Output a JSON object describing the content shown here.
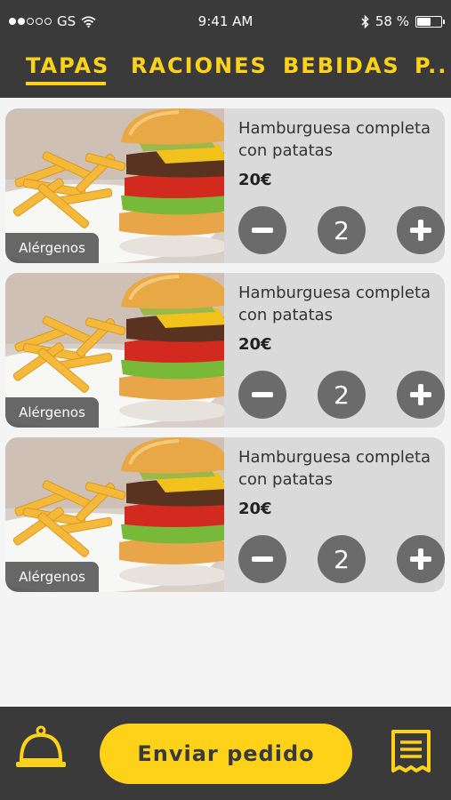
{
  "status_bar": {
    "carrier": "GS",
    "time": "9:41 AM",
    "battery": "58 %",
    "battery_level": 0.58,
    "signal_bars": 2
  },
  "tabs": [
    {
      "label": "TAPAS",
      "active": true
    },
    {
      "label": "RACIONES",
      "active": false
    },
    {
      "label": "BEBIDAS",
      "active": false
    },
    {
      "label": "P..",
      "active": false
    }
  ],
  "items": [
    {
      "name": "Hamburguesa completa con patatas",
      "price": "20€",
      "quantity": "2",
      "allergen_label": "Alérgenos"
    },
    {
      "name": "Hamburguesa completa con patatas",
      "price": "20€",
      "quantity": "2",
      "allergen_label": "Alérgenos"
    },
    {
      "name": "Hamburguesa completa con patatas",
      "price": "20€",
      "quantity": "2",
      "allergen_label": "Alérgenos"
    }
  ],
  "footer": {
    "send_label": "Enviar pedido",
    "left_icon": "service-bell-icon",
    "right_icon": "receipt-icon"
  },
  "colors": {
    "accent": "#ffd21a",
    "bar": "#3a3a3a",
    "card": "#dadada",
    "control": "#6b6b6b"
  }
}
